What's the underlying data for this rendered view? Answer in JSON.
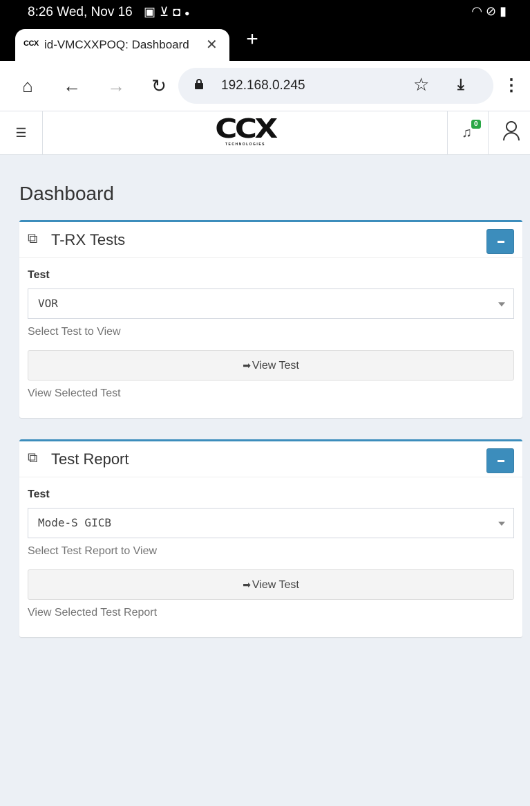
{
  "status_bar": {
    "time": "8:26  Wed, Nov 16",
    "left_icons": [
      "image-icon",
      "download-done-icon",
      "screen-icon",
      "dot-icon"
    ],
    "right_icons": [
      "wifi-icon",
      "dnd-icon",
      "battery-icon"
    ]
  },
  "browser": {
    "tab": {
      "favicon_text": "CCX",
      "title": "id-VMCXXPOQ: Dashboard",
      "close_glyph": "✕"
    },
    "new_tab_glyph": "+",
    "url": "192.168.0.245"
  },
  "header": {
    "logo_text": "CCX",
    "logo_subtext": "TECHNOLOGIES",
    "notification_count": "0",
    "colors": {
      "badge": "#28a745"
    }
  },
  "page": {
    "title": "Dashboard"
  },
  "cards": [
    {
      "title": "T-RX Tests",
      "field_label": "Test",
      "selected_value": "VOR",
      "help_text": "Select Test to View",
      "button_label": "View Test",
      "footer_text": "View Selected Test"
    },
    {
      "title": "Test Report",
      "field_label": "Test",
      "selected_value": "Mode-S GICB",
      "help_text": "Select Test Report to View",
      "button_label": "View Test",
      "footer_text": "View Selected Test Report"
    }
  ],
  "colors": {
    "accent": "#3c8dbc",
    "content_bg": "#ecf0f5"
  }
}
